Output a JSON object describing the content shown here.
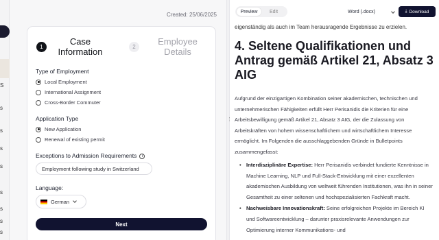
{
  "sidebar_fragments": [
    "S",
    "s",
    "s",
    "s",
    "s",
    "s",
    "s",
    "s",
    "s"
  ],
  "form": {
    "created": "Created: 25/06/2025",
    "steps": [
      {
        "num": "1",
        "label_line1": "Case",
        "label_line2": "Information"
      },
      {
        "num": "2",
        "label_line1": "Employee",
        "label_line2": "Details"
      }
    ],
    "employment_type": {
      "title": "Type of Employment",
      "options": [
        "Local Employment",
        "International Assignment",
        "Cross-Border Commuter"
      ]
    },
    "application_type": {
      "title": "Application Type",
      "options": [
        "New Application",
        "Renewal of existing permit"
      ]
    },
    "exceptions": {
      "title": "Exceptions to Admission Requirements",
      "value": "Employment following study in Switzerland"
    },
    "language": {
      "title": "Language:",
      "value": "German"
    },
    "next_label": "Next"
  },
  "preview": {
    "tab_preview": "Preview",
    "tab_edit": "Edit",
    "format": "Word (.docx)",
    "download_label": "Download",
    "top_line": "eigenständig als auch im Team herausragende Ergebnisse zu erzielen.",
    "heading": "4. Seltene Qualifikationen und Antrag gemäß Artikel 21, Absatz 3 AIG",
    "paragraph": "Aufgrund der einzigartigen Kombination seiner akademischen, technischen und unternehmerischen Fähigkeiten erfüllt Herr Perisanidis die Kriterien für eine Arbeitsbewilligung gemäß Artikel 21, Absatz 3 AIG, der die Zulassung von Arbeitskräften von hohem wissenschaftlichem und wirtschaftlichem Interesse ermöglicht. Im Folgenden die ausschlaggebenden Gründe in Bulletpoints zusammengefasst:",
    "bullets": [
      {
        "bold": "Interdisziplinäre Expertise:",
        "text": " Herr Perisanidis verbindet fundierte Kenntnisse in Machine Learning, NLP und Full-Stack-Entwicklung mit einer exzellenten akademischen Ausbildung von weltweit führenden Institutionen, was ihn in seiner Gesamtheit zu einer seltenen und hochspezialisierten Fachkraft macht."
      },
      {
        "bold": "Nachweisbare Innovationskraft:",
        "text": " Seine erfolgreichen Projekte im Bereich KI und Softwareentwicklung – darunter praxisrelevante Anwendungen zur Optimierung interner Kommunikations- und"
      }
    ]
  }
}
